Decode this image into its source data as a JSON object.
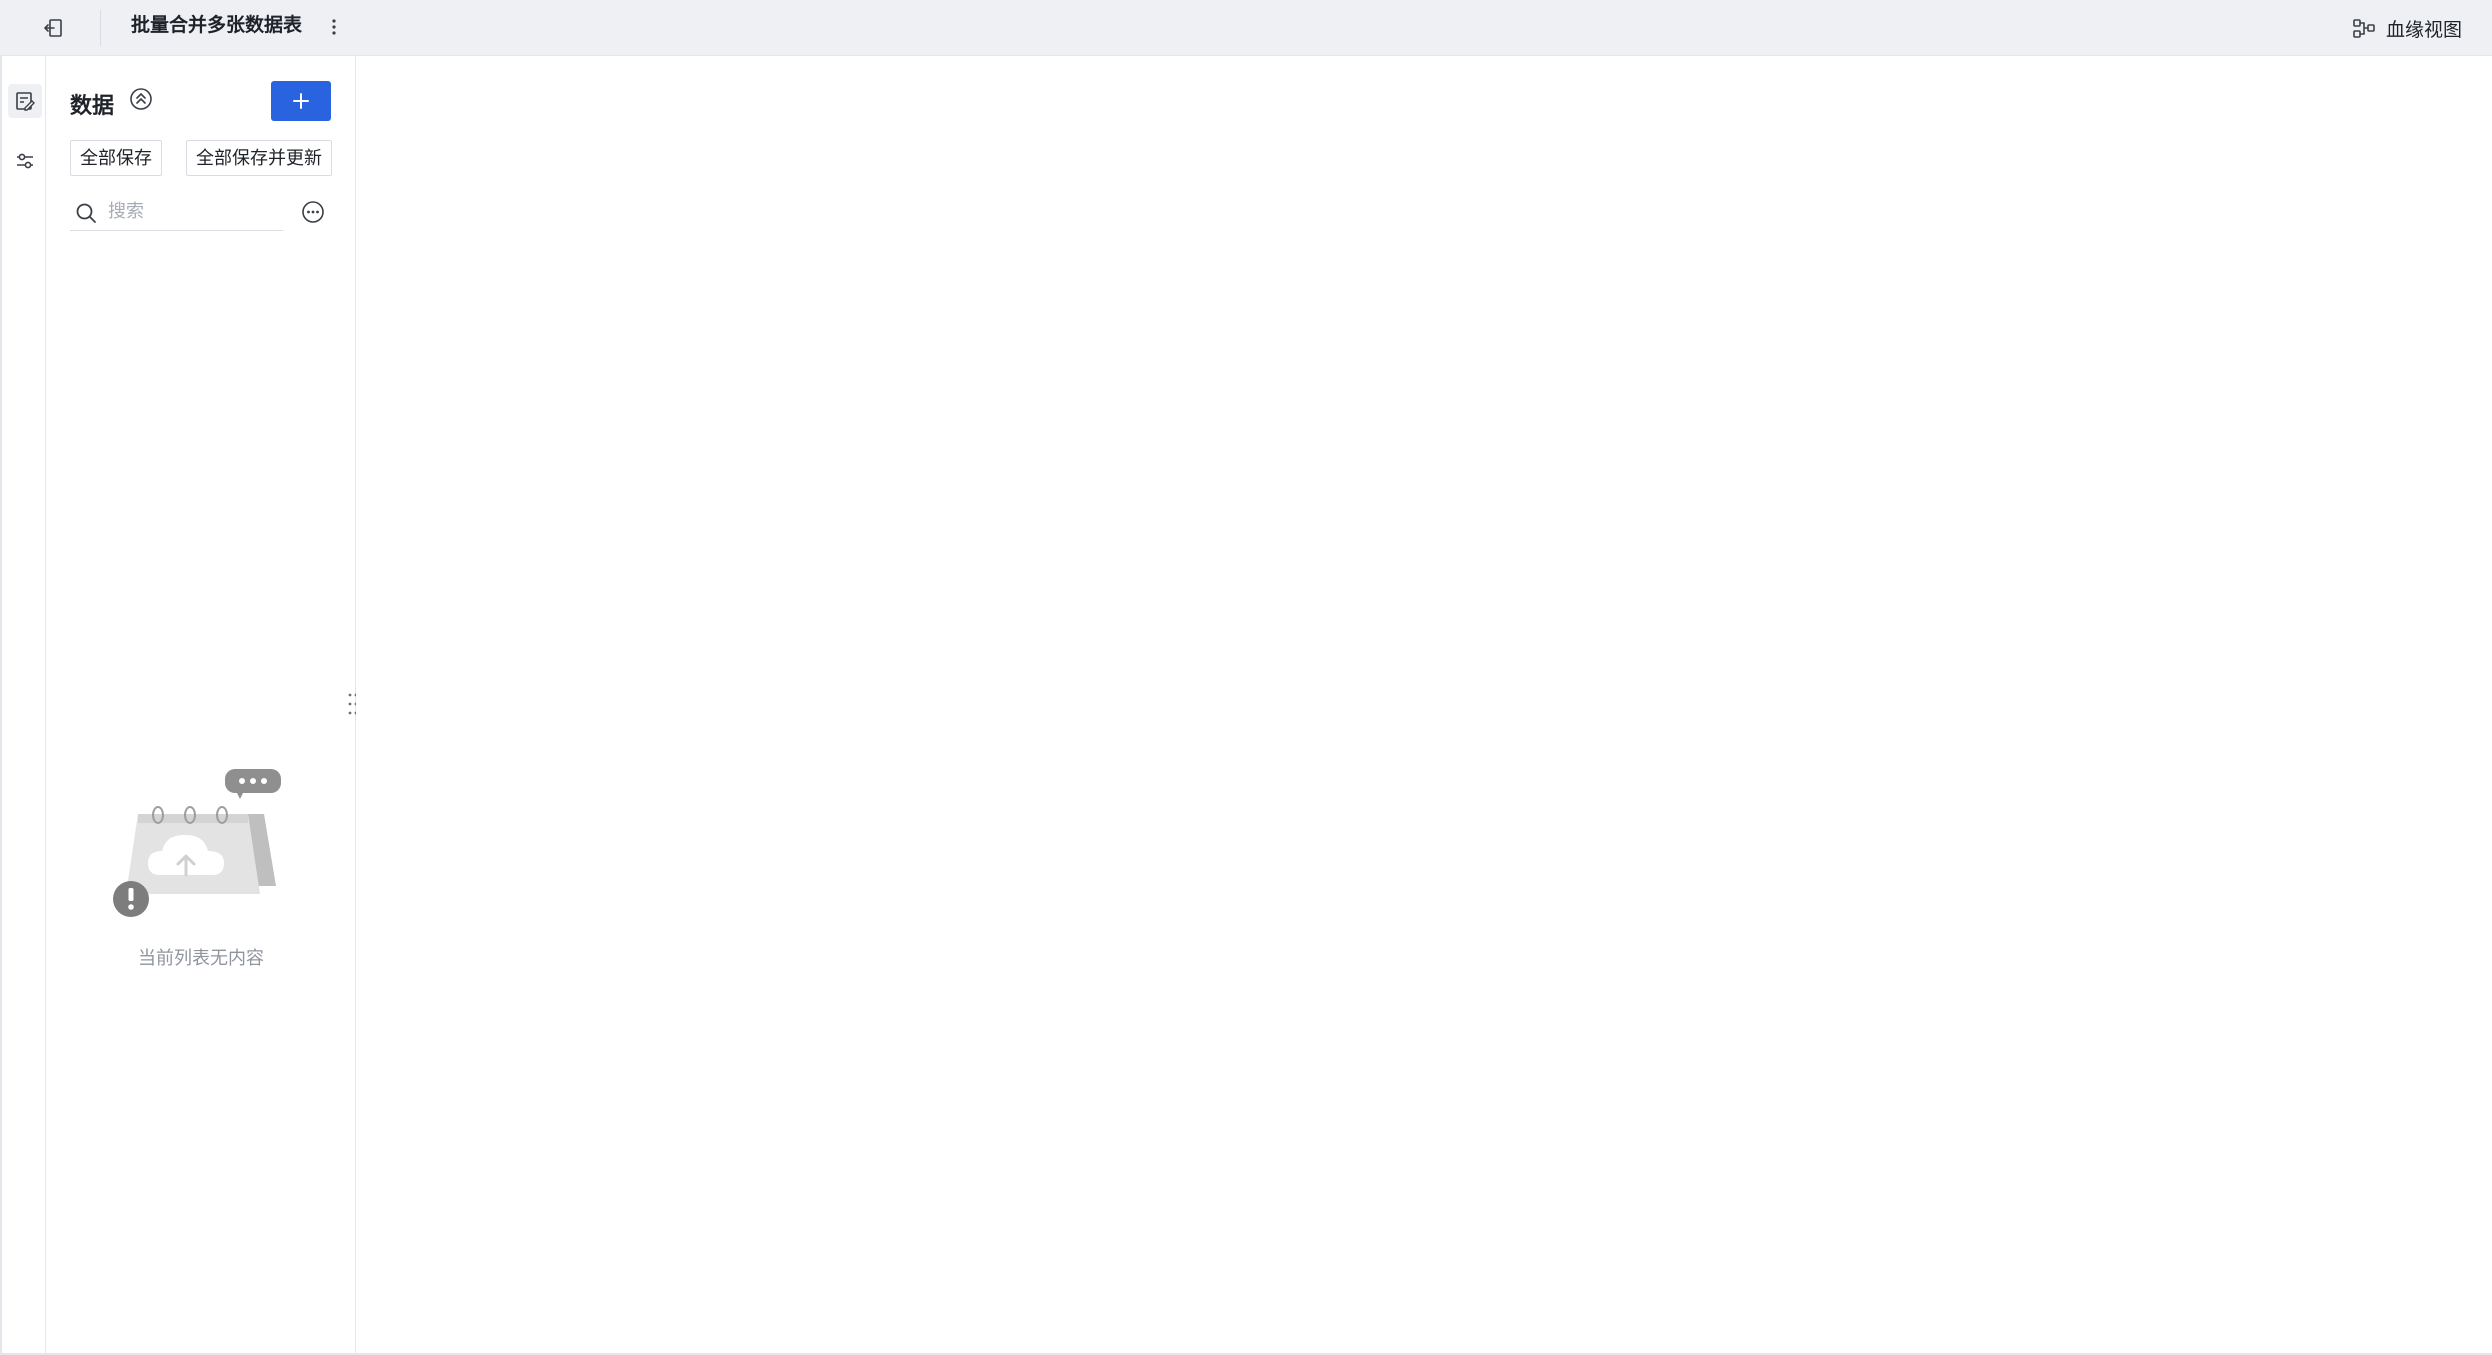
{
  "header": {
    "title": "批量合并多张数据表",
    "lineage_label": "血缘视图"
  },
  "panel": {
    "title": "数据",
    "save_all_label": "全部保存",
    "save_all_update_label": "全部保存并更新",
    "search": {
      "placeholder": "搜索",
      "value": ""
    },
    "empty_text": "当前列表无内容"
  },
  "colors": {
    "accent": "#2a63e0",
    "topbar_bg": "#eef0f4",
    "muted_text": "#8f959e"
  },
  "icons": {
    "back": "exit-icon",
    "more": "more-vertical-icon",
    "lineage": "lineage-icon",
    "rail_data": "data-edit-icon",
    "rail_transform": "sliders-icon",
    "collapse": "collapse-up-icon",
    "add": "plus-icon",
    "search": "search-icon",
    "filter": "more-circle-icon"
  }
}
